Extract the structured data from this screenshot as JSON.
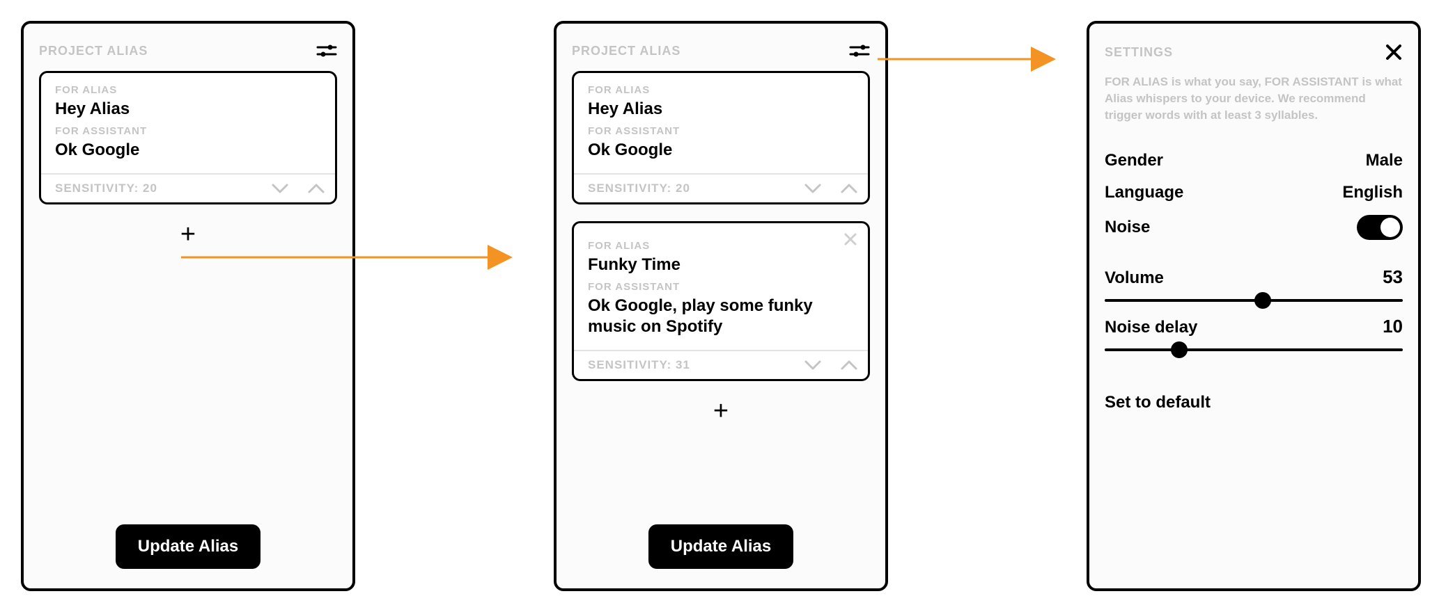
{
  "app_title": "PROJECT ALIAS",
  "sensitivity_prefix": "SENSITIVITY: ",
  "update_button": "Update Alias",
  "panel1": {
    "card": {
      "for_alias_label": "FOR ALIAS",
      "for_alias_value": "Hey Alias",
      "for_assistant_label": "FOR ASSISTANT",
      "for_assistant_value": "Ok Google",
      "sensitivity": "20"
    }
  },
  "panel2": {
    "cards": [
      {
        "for_alias_label": "FOR ALIAS",
        "for_alias_value": "Hey Alias",
        "for_assistant_label": "FOR ASSISTANT",
        "for_assistant_value": "Ok Google",
        "sensitivity": "20"
      },
      {
        "for_alias_label": "FOR ALIAS",
        "for_alias_value": "Funky Time",
        "for_assistant_label": "FOR ASSISTANT",
        "for_assistant_value": "Ok Google, play some funky music on Spotify",
        "sensitivity": "31"
      }
    ]
  },
  "settings": {
    "title": "SETTINGS",
    "help": "FOR ALIAS is what you say, FOR ASSISTANT is what Alias whispers to your device. We recommend trigger words with at least 3 syllables.",
    "gender": {
      "label": "Gender",
      "value": "Male"
    },
    "language": {
      "label": "Language",
      "value": "English"
    },
    "noise": {
      "label": "Noise",
      "on": true
    },
    "volume": {
      "label": "Volume",
      "value": "53",
      "percent": 53
    },
    "noise_delay": {
      "label": "Noise delay",
      "value": "10",
      "percent": 25
    },
    "reset": "Set to default"
  }
}
